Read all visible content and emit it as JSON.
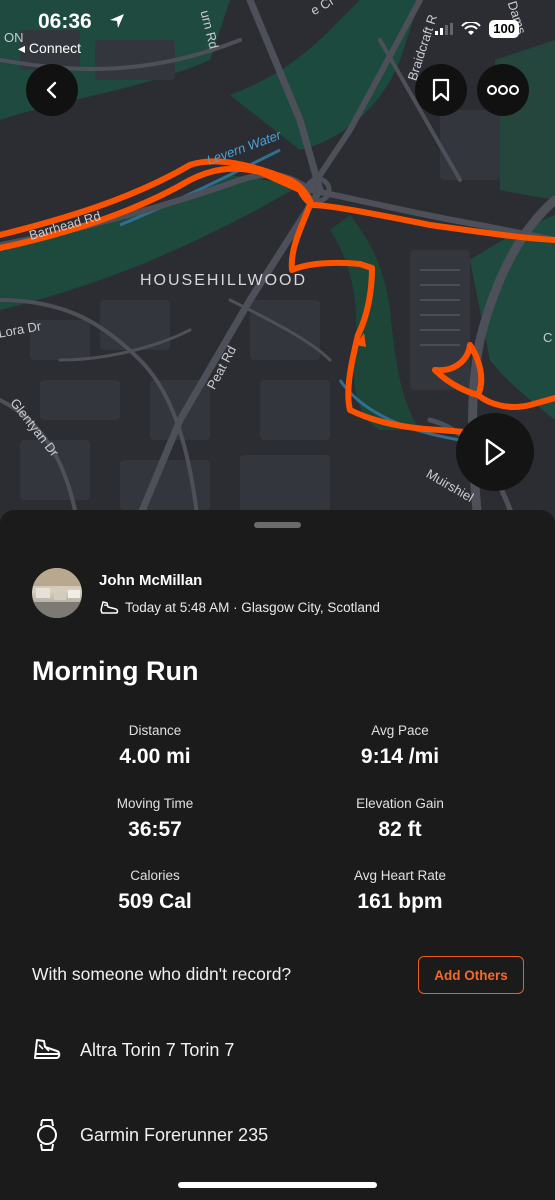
{
  "status_bar": {
    "time": "06:36",
    "back_app": "Connect",
    "battery": "100"
  },
  "map": {
    "labels": {
      "district": "HOUSEHILLWOOD",
      "water": "Levern Water",
      "road_barrhead": "Barrhead Rd",
      "road_peat": "Peat Rd",
      "road_glentyan": "Glentyan Dr",
      "road_lora": "Lora Dr",
      "road_urn": "urn Rd",
      "road_braidcraft": "Braidcraft R",
      "road_muirshiel": "Muirshiel",
      "road_dams": "Dams",
      "partial_on": "ON",
      "partial_cr": "e Cr",
      "partial_c": "C"
    },
    "route_color": "#fc5200"
  },
  "toolbar": {
    "back_icon": "chevron-left-icon",
    "bookmark_icon": "bookmark-icon",
    "more_icon": "more-icon",
    "play_icon": "play-icon"
  },
  "activity": {
    "athlete_name": "John McMillan",
    "meta": "Today at 5:48 AM · Glasgow City, Scotland",
    "title": "Morning Run"
  },
  "stats": [
    {
      "label": "Distance",
      "value": "4.00 mi"
    },
    {
      "label": "Avg Pace",
      "value": "9:14 /mi"
    },
    {
      "label": "Moving Time",
      "value": "36:57"
    },
    {
      "label": "Elevation Gain",
      "value": "82 ft"
    },
    {
      "label": "Calories",
      "value": "509 Cal"
    },
    {
      "label": "Avg Heart Rate",
      "value": "161 bpm"
    }
  ],
  "others": {
    "prompt": "With someone who didn't record?",
    "button_label": "Add Others"
  },
  "gear": {
    "shoes": "Altra Torin 7 Torin 7",
    "device": "Garmin Forerunner 235"
  },
  "colors": {
    "accent": "#fc5200",
    "sheet_bg": "#1b1b1b",
    "map_bg": "#2b2d33"
  }
}
